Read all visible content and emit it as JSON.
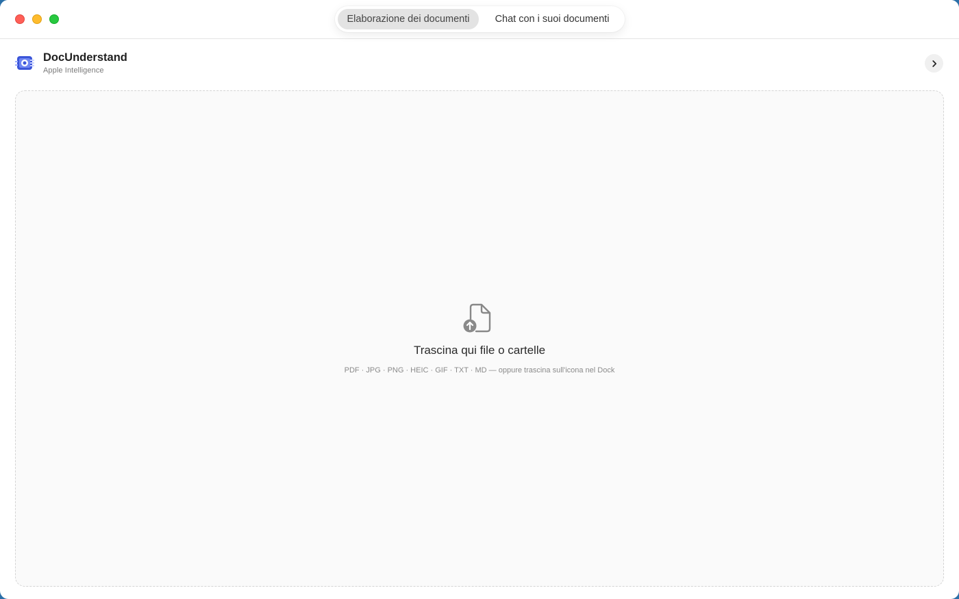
{
  "tabs": [
    {
      "label": "Elaborazione dei documenti",
      "selected": true
    },
    {
      "label": "Chat con i suoi documenti",
      "selected": false
    }
  ],
  "header": {
    "title": "DocUnderstand",
    "subtitle": "Apple Intelligence",
    "expand_icon": "chevron-right-icon"
  },
  "dropzone": {
    "icon": "document-upload-icon",
    "title": "Trascina qui file o cartelle",
    "subtitle": "PDF · JPG · PNG · HEIC · GIF · TXT · MD — oppure trascina sull'icona nel Dock"
  },
  "colors": {
    "close": "#ff5f57",
    "minimize": "#febc2e",
    "maximize": "#28c840",
    "selected_tab": "#e3e3e3"
  }
}
